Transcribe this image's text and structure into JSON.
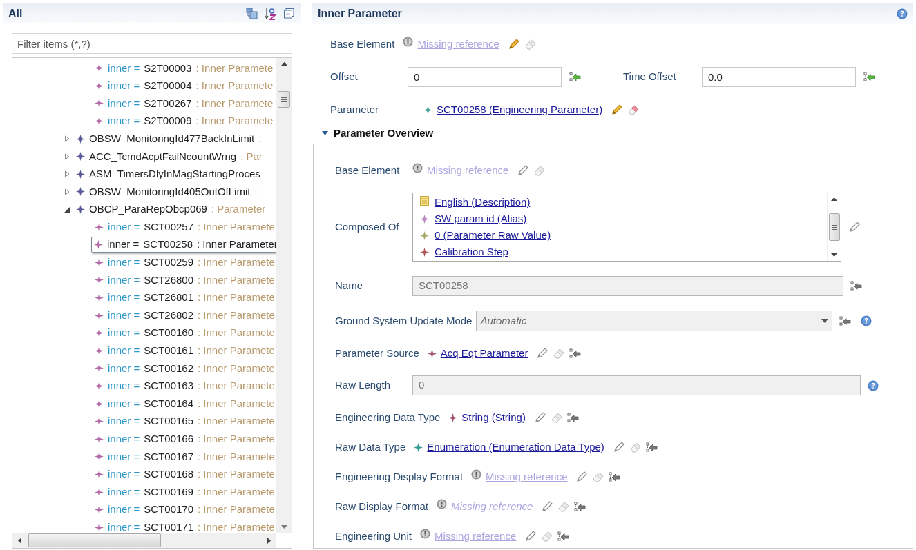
{
  "left_panel": {
    "title": "All",
    "filter": {
      "placeholder": "Filter items (*,?)"
    },
    "tree": {
      "continued_children": [
        {
          "prefix": "inner =",
          "name": "S2T00003",
          "type": ": Inner Paramete",
          "selected": false
        },
        {
          "prefix": "inner =",
          "name": "S2T00004",
          "type": ": Inner Paramete",
          "selected": false
        },
        {
          "prefix": "inner =",
          "name": "S2T00267",
          "type": ": Inner Paramete",
          "selected": false
        },
        {
          "prefix": "inner =",
          "name": "S2T00009",
          "type": ": Inner Paramete",
          "selected": false
        }
      ],
      "items": [
        {
          "name": "OBSW_MonitoringId477BackInLimit",
          "type": ":",
          "expanded": false
        },
        {
          "name": "ACC_TcmdAcptFailNcountWrng",
          "type": ": Par",
          "expanded": false
        },
        {
          "name": "ASM_TimersDlyInMagStartingProces",
          "expanded": false
        },
        {
          "name": "OBSW_MonitoringId405OutOfLimit",
          "type": ":",
          "expanded": false
        },
        {
          "name": "OBCP_ParaRepObcp069",
          "type": ": Parameter",
          "expanded": true,
          "children": [
            {
              "prefix": "inner =",
              "name": "SCT00257",
              "type": ": Inner Paramete",
              "selected": false
            },
            {
              "prefix": "inner =",
              "name": "SCT00258",
              "type": ": Inner Parameter",
              "selected": true
            },
            {
              "prefix": "inner =",
              "name": "SCT00259",
              "type": ": Inner Paramete",
              "selected": false
            },
            {
              "prefix": "inner =",
              "name": "SCT26800",
              "type": ": Inner Paramete",
              "selected": false
            },
            {
              "prefix": "inner =",
              "name": "SCT26801",
              "type": ": Inner Paramete",
              "selected": false
            },
            {
              "prefix": "inner =",
              "name": "SCT26802",
              "type": ": Inner Paramete",
              "selected": false
            },
            {
              "prefix": "inner =",
              "name": "SCT00160",
              "type": ": Inner Paramete",
              "selected": false
            },
            {
              "prefix": "inner =",
              "name": "SCT00161",
              "type": ": Inner Paramete",
              "selected": false
            },
            {
              "prefix": "inner =",
              "name": "SCT00162",
              "type": ": Inner Paramete",
              "selected": false
            },
            {
              "prefix": "inner =",
              "name": "SCT00163",
              "type": ": Inner Paramete",
              "selected": false
            },
            {
              "prefix": "inner =",
              "name": "SCT00164",
              "type": ": Inner Paramete",
              "selected": false
            },
            {
              "prefix": "inner =",
              "name": "SCT00165",
              "type": ": Inner Paramete",
              "selected": false
            },
            {
              "prefix": "inner =",
              "name": "SCT00166",
              "type": ": Inner Paramete",
              "selected": false
            },
            {
              "prefix": "inner =",
              "name": "SCT00167",
              "type": ": Inner Paramete",
              "selected": false
            },
            {
              "prefix": "inner =",
              "name": "SCT00168",
              "type": ": Inner Paramete",
              "selected": false
            },
            {
              "prefix": "inner =",
              "name": "SCT00169",
              "type": ": Inner Paramete",
              "selected": false
            },
            {
              "prefix": "inner =",
              "name": "SCT00170",
              "type": ": Inner Paramete",
              "selected": false
            },
            {
              "prefix": "inner =",
              "name": "SCT00171",
              "type": ": Inner Paramete",
              "selected": false
            }
          ]
        }
      ]
    }
  },
  "right_panel": {
    "title": "Inner Parameter",
    "top_fields": [
      {
        "kind": "reference",
        "label": "Base Element",
        "value": "Missing reference",
        "missing": true,
        "italic": false,
        "active": true,
        "unset": false,
        "help": false
      },
      {
        "kind": "pair",
        "fields": [
          {
            "label": "Offset",
            "value": "0"
          },
          {
            "label": "Time Offset",
            "value": "0.0"
          }
        ]
      },
      {
        "kind": "reference",
        "label": "Parameter",
        "value": "SCT00258 (Engineering Parameter)",
        "missing": false,
        "italic": false,
        "color": "#4aa39a",
        "active": true,
        "unset": false,
        "help": false
      }
    ],
    "section": {
      "title": "Parameter Overview",
      "expanded": true,
      "fields": [
        {
          "kind": "reference",
          "label": "Base Element",
          "value": "Missing reference",
          "missing": true,
          "italic": false,
          "active": false,
          "unset": false,
          "help": false
        },
        {
          "kind": "list",
          "label": "Composed Of",
          "items": [
            {
              "kind": "note",
              "text": "English (Description)"
            },
            {
              "kind": "star",
              "text": "SW param id (Alias)",
              "color": "#b98ac0"
            },
            {
              "kind": "star",
              "text": "0 (Parameter Raw Value)",
              "color": "#a6a86a"
            },
            {
              "kind": "star",
              "text": "Calibration Step",
              "color": "#b0555a"
            }
          ]
        },
        {
          "kind": "readonly",
          "label": "Name",
          "value": "SCT00258",
          "unset": true,
          "help": false
        },
        {
          "kind": "combo",
          "label": "Ground System Update Mode",
          "value": "Automatic",
          "unset": true,
          "help": true
        },
        {
          "kind": "reference",
          "label": "Parameter Source",
          "value": "Acq Eqt Parameter",
          "missing": false,
          "italic": false,
          "color": "#a8547a",
          "active": false,
          "unset": true,
          "help": false
        },
        {
          "kind": "readonly",
          "label": "Raw Length",
          "value": "0",
          "unset": false,
          "help": true
        },
        {
          "kind": "reference",
          "label": "Engineering Data Type",
          "value": "String (String)",
          "missing": false,
          "italic": false,
          "color": "#a8506a",
          "active": false,
          "unset": true,
          "help": false
        },
        {
          "kind": "reference",
          "label": "Raw Data Type",
          "value": "Enumeration (Enumeration Data Type)",
          "missing": false,
          "italic": false,
          "color": "#3a9c94",
          "active": false,
          "unset": true,
          "help": false
        },
        {
          "kind": "reference",
          "label": "Engineering Display Format",
          "value": "Missing reference",
          "missing": true,
          "italic": false,
          "active": false,
          "unset": true,
          "help": false
        },
        {
          "kind": "reference",
          "label": "Raw Display Format",
          "value": "Missing reference",
          "missing": true,
          "italic": true,
          "active": false,
          "unset": true,
          "help": false
        },
        {
          "kind": "reference",
          "label": "Engineering Unit",
          "value": "Missing reference",
          "missing": true,
          "italic": false,
          "active": false,
          "unset": true,
          "help": false
        }
      ]
    }
  }
}
